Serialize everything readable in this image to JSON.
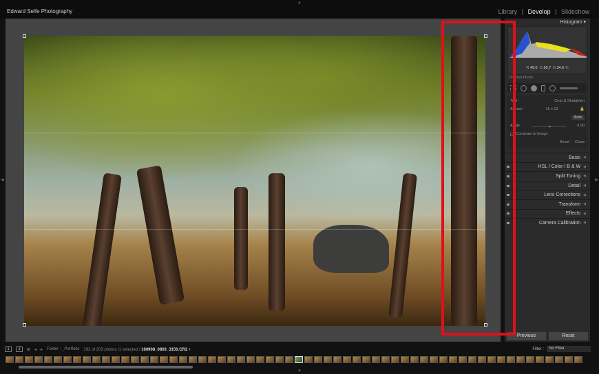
{
  "app": {
    "brand": "Edward Selfe Photography"
  },
  "modules": {
    "library": "Library",
    "sep1": "|",
    "develop": "Develop",
    "sep2": "|",
    "slideshow": "Slideshow"
  },
  "histogram": {
    "title": "Histogram",
    "r_label": "R",
    "r": "49.0",
    "g_label": "G",
    "g": "50.7",
    "b_label": "B",
    "b": "34.6",
    "unit": "%",
    "original_photo": "Original Photo"
  },
  "crop": {
    "tool_label": "Tool :",
    "tool_name": "Crop & Straighten",
    "aspect_label": "Aspect :",
    "aspect_value": "16 x 10",
    "auto": "Auto",
    "angle_label": "Angle",
    "angle_value": "0.00",
    "constrain": "Constrain to Image",
    "reset": "Reset",
    "close": "Close",
    "angle_slider": 0.5
  },
  "sections": [
    "Basic",
    "HSL / Color / B & W",
    "Split Toning",
    "Detail",
    "Lens Corrections",
    "Transform",
    "Effects",
    "Camera Calibration"
  ],
  "buttons": {
    "previous": "Previous",
    "reset": "Reset"
  },
  "filmstrip": {
    "page1": "1",
    "page2": "2",
    "folder": "Folder : _Portfolio",
    "count": "192 of 203 photos /1 selected /",
    "filename": "160908_0803_3150.CR2",
    "filter_label": "Filter :",
    "filter_value": "No Filter"
  },
  "colors": {
    "highlight_box": "#e0101a"
  }
}
